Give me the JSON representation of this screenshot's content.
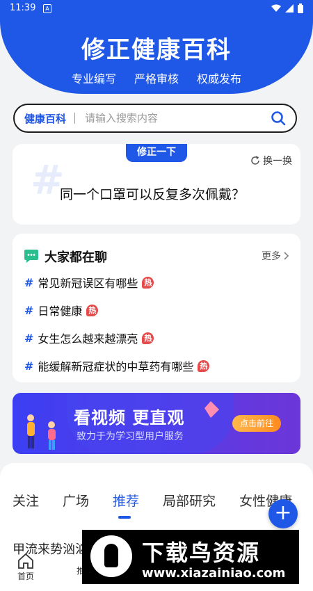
{
  "status_bar": {
    "time": "11:39",
    "sim_glyph": "A"
  },
  "header": {
    "title": "修正健康百科",
    "tags": [
      "专业编写",
      "严格审核",
      "权威发布"
    ]
  },
  "search": {
    "brand": "健康百科",
    "placeholder": "请输入搜索内容"
  },
  "question_card": {
    "badge": "修正一下",
    "refresh_label": "换一换",
    "question": "同一个口罩可以反复多次佩戴？"
  },
  "discussion": {
    "title": "大家都在聊",
    "more_label": "更多",
    "hot_label": "热",
    "topics": [
      {
        "text": "常见新冠误区有哪些"
      },
      {
        "text": "日常健康"
      },
      {
        "text": "女生怎么越来越漂亮"
      },
      {
        "text": "能缓解新冠症状的中草药有哪些"
      }
    ]
  },
  "banner": {
    "headline": "看视频 更直观",
    "subline": "致力于为学习型用户服务",
    "button": "点击前往"
  },
  "tabs": {
    "items": [
      "关注",
      "广场",
      "推荐",
      "局部研究",
      "女性健康"
    ],
    "active_index": 2
  },
  "feed": {
    "first_title_partial": "甲流来势汹汹"
  },
  "bottom_nav": {
    "home_label": "首页",
    "second_label": "推"
  },
  "watermark": {
    "main": "下载鸟资源",
    "url": "www.xiazainiao.com"
  },
  "colors": {
    "accent": "#1f57e6",
    "hot": "#e64a4a"
  }
}
